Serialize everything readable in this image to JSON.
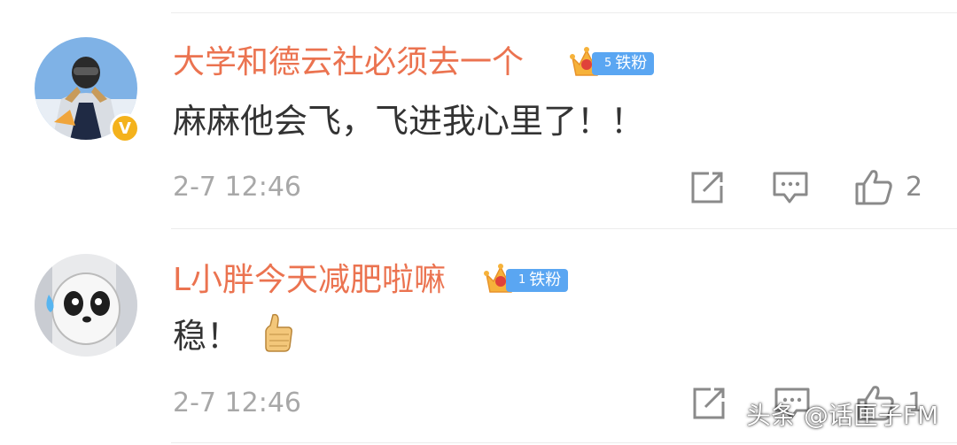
{
  "comments": [
    {
      "username": "大学和德云社必须去一个",
      "fan_level": "5",
      "fan_badge": "铁粉",
      "verified_mark": "V",
      "content": "麻麻他会飞，飞进我心里了！！",
      "timestamp": "2-7 12:46",
      "like_count": "2"
    },
    {
      "username": "L小胖今天减肥啦嘛",
      "fan_level": "1",
      "fan_badge": "铁粉",
      "content": "稳！",
      "content_emoji": "thumbs-up-emoji",
      "timestamp": "2-7 12:46",
      "like_count": "1"
    }
  ],
  "watermark": "头条 @话匣子FM",
  "colors": {
    "username": "#eb7350",
    "fan_badge": "#5aa6f2",
    "text": "#333333",
    "meta": "#a8a8a8",
    "icon": "#8a8a8a"
  },
  "icons": [
    "share-icon",
    "comment-icon",
    "like-icon"
  ]
}
